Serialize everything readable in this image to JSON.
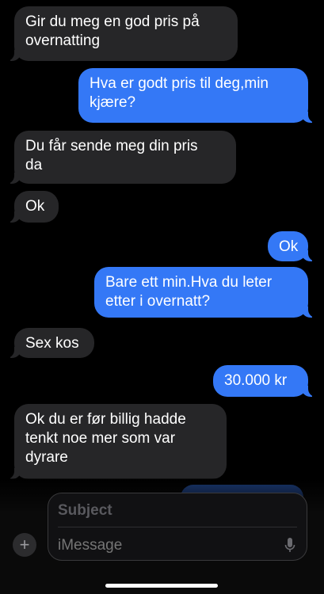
{
  "messages": [
    {
      "direction": "incoming",
      "text": "Gir du meg en god pris på\novernatting"
    },
    {
      "direction": "outgoing",
      "text": "Hva er godt pris til deg,min\nkjære?"
    },
    {
      "direction": "incoming",
      "text": "Du får sende meg din pris\nda"
    },
    {
      "direction": "incoming",
      "text": "Ok"
    },
    {
      "direction": "outgoing",
      "text": "Ok"
    },
    {
      "direction": "outgoing",
      "text": "Bare ett min.Hva du leter\netter i overnatt?"
    },
    {
      "direction": "incoming",
      "text": "Sex kos"
    },
    {
      "direction": "outgoing",
      "text": "30.000 kr"
    },
    {
      "direction": "incoming",
      "text": "Ok du er før billig  hadde\ntenkt noe mer som var\ndyrare"
    }
  ],
  "composer": {
    "subject_placeholder": "Subject",
    "message_placeholder": "iMessage",
    "add_icon": "plus-icon",
    "mic_icon": "microphone-icon"
  },
  "colors": {
    "incoming_bubble": "#262628",
    "outgoing_bubble": "#3478f6",
    "background": "#000000"
  }
}
